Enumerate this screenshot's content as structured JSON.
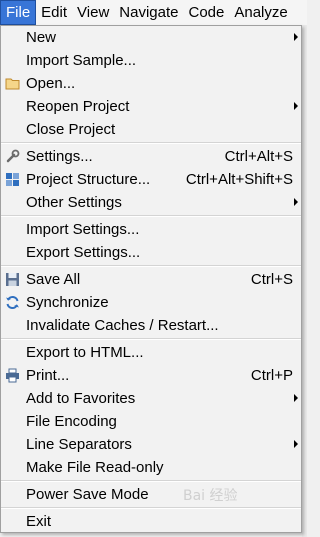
{
  "menubar": {
    "items": [
      {
        "label": "File",
        "active": true
      },
      {
        "label": "Edit"
      },
      {
        "label": "View"
      },
      {
        "label": "Navigate"
      },
      {
        "label": "Code"
      },
      {
        "label": "Analyze"
      }
    ]
  },
  "menu": {
    "items": [
      {
        "label": "New",
        "submenu": true
      },
      {
        "label": "Import Sample..."
      },
      {
        "label": "Open...",
        "icon": "folder-icon"
      },
      {
        "label": "Reopen Project",
        "submenu": true
      },
      {
        "label": "Close Project"
      },
      {
        "label": "Settings...",
        "shortcut": "Ctrl+Alt+S",
        "icon": "wrench-icon"
      },
      {
        "label": "Project Structure...",
        "shortcut": "Ctrl+Alt+Shift+S",
        "icon": "project-structure-icon"
      },
      {
        "label": "Other Settings",
        "submenu": true
      },
      {
        "label": "Import Settings..."
      },
      {
        "label": "Export Settings..."
      },
      {
        "label": "Save All",
        "shortcut": "Ctrl+S",
        "icon": "save-icon"
      },
      {
        "label": "Synchronize",
        "icon": "sync-icon"
      },
      {
        "label": "Invalidate Caches / Restart..."
      },
      {
        "label": "Export to HTML..."
      },
      {
        "label": "Print...",
        "shortcut": "Ctrl+P",
        "icon": "printer-icon"
      },
      {
        "label": "Add to Favorites",
        "submenu": true
      },
      {
        "label": "File Encoding"
      },
      {
        "label": "Line Separators",
        "submenu": true
      },
      {
        "label": "Make File Read-only"
      },
      {
        "label": "Power Save Mode"
      },
      {
        "label": "Exit"
      }
    ]
  },
  "watermark": "Bai 经验",
  "colors": {
    "active_menu_bg": "#3875d7",
    "menu_bg": "#f2f2f2",
    "icon_blue": "#2f6fbf",
    "folder_orange": "#d9a441"
  }
}
